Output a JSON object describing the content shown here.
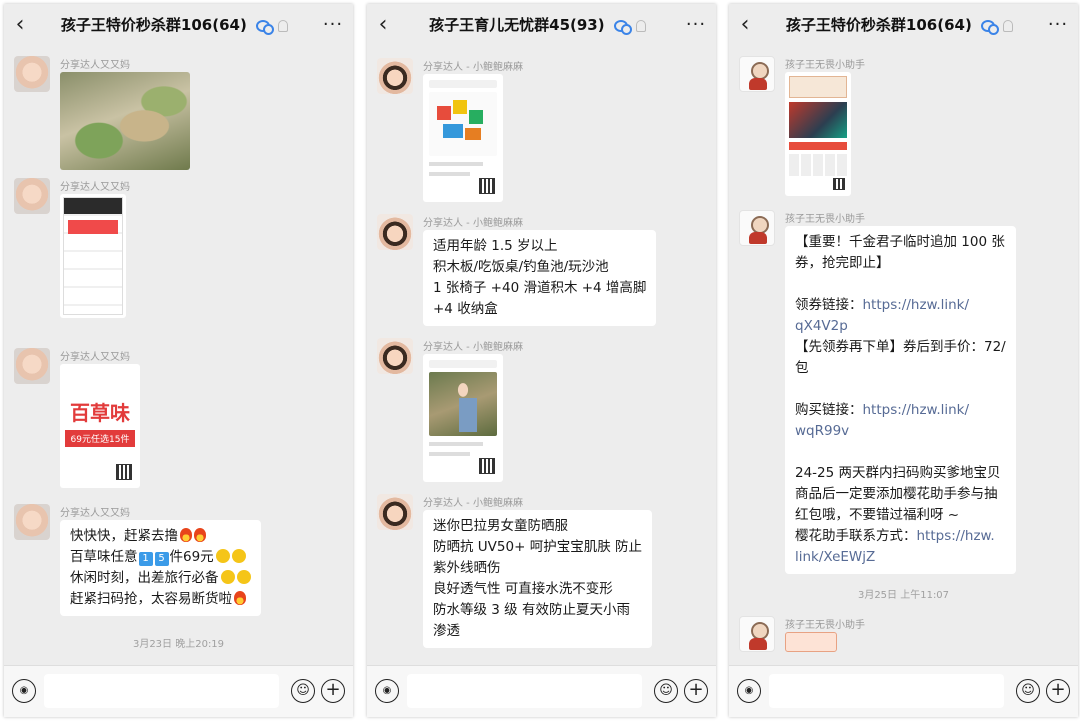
{
  "phones": [
    {
      "title": "孩子王特价秒杀群106(64)",
      "messages": [
        {
          "sender": "分享达人又又妈"
        },
        {
          "sender": "分享达人又又妈"
        },
        {
          "sender": "分享达人又又妈",
          "card_brand": "百草味",
          "card_band": "69元任选15件"
        },
        {
          "sender": "分享达人又又妈",
          "lines": [
            "快快快，赶紧去撸",
            "百草味任意",
            "件69元",
            "休闲时刻，出差旅行必备",
            "赶紧扫码抢，太容易断货啦"
          ],
          "digits": [
            "1",
            "5"
          ]
        }
      ],
      "timestamp": "3月23日 晚上20:19"
    },
    {
      "title": "孩子王育儿无忧群45(93)",
      "messages": [
        {
          "sender": "分享达人 - 小鲍鲍麻麻"
        },
        {
          "sender": "分享达人 - 小鲍鲍麻麻",
          "lines": [
            "适用年龄 1.5 岁以上",
            "积木板/吃饭桌/钓鱼池/玩沙池",
            "1 张椅子 +40 滑道积木 +4 增高脚",
            "+4 收纳盒"
          ]
        },
        {
          "sender": "分享达人 - 小鲍鲍麻麻"
        },
        {
          "sender": "分享达人 - 小鲍鲍麻麻",
          "lines": [
            "迷你巴拉男女童防晒服",
            "防晒抗 UV50+ 呵护宝宝肌肤 防止",
            "紫外线晒伤",
            "良好透气性 可直接水洗不变形",
            "防水等级 3 级  有效防止夏天小雨",
            "渗透"
          ]
        }
      ]
    },
    {
      "title": "孩子王特价秒杀群106(64)",
      "messages": [
        {
          "sender": "孩子王无畏小助手"
        },
        {
          "sender": "孩子王无畏小助手",
          "lines": [
            "【重要！千金君子临时追加 100 张",
            "券，抢完即止】",
            "",
            "领券链接：",
            "https://hzw.link/",
            "qX4V2p",
            "【先领券再下单】券后到手价：72/",
            "包",
            "",
            "购买链接：",
            "https://hzw.link/",
            "wqR99v",
            "",
            "24-25 两天群内扫码购买爹地宝贝",
            "商品后一定要添加樱花助手参与抽",
            "红包哦，不要错过福利呀 ~",
            "樱花助手联系方式：",
            "https://hzw.",
            "link/XeEWjZ"
          ]
        },
        {
          "sender": "孩子王无畏小助手"
        }
      ],
      "timestamp": "3月25日 上午11:07"
    }
  ],
  "icons": {
    "back": "‹",
    "more": "···",
    "voice": "◉",
    "emoji": "☺",
    "plus": "+"
  },
  "colors": {
    "chat_bg": "#ededed",
    "link": "#576b95",
    "group_icon": "#3b84e8"
  }
}
